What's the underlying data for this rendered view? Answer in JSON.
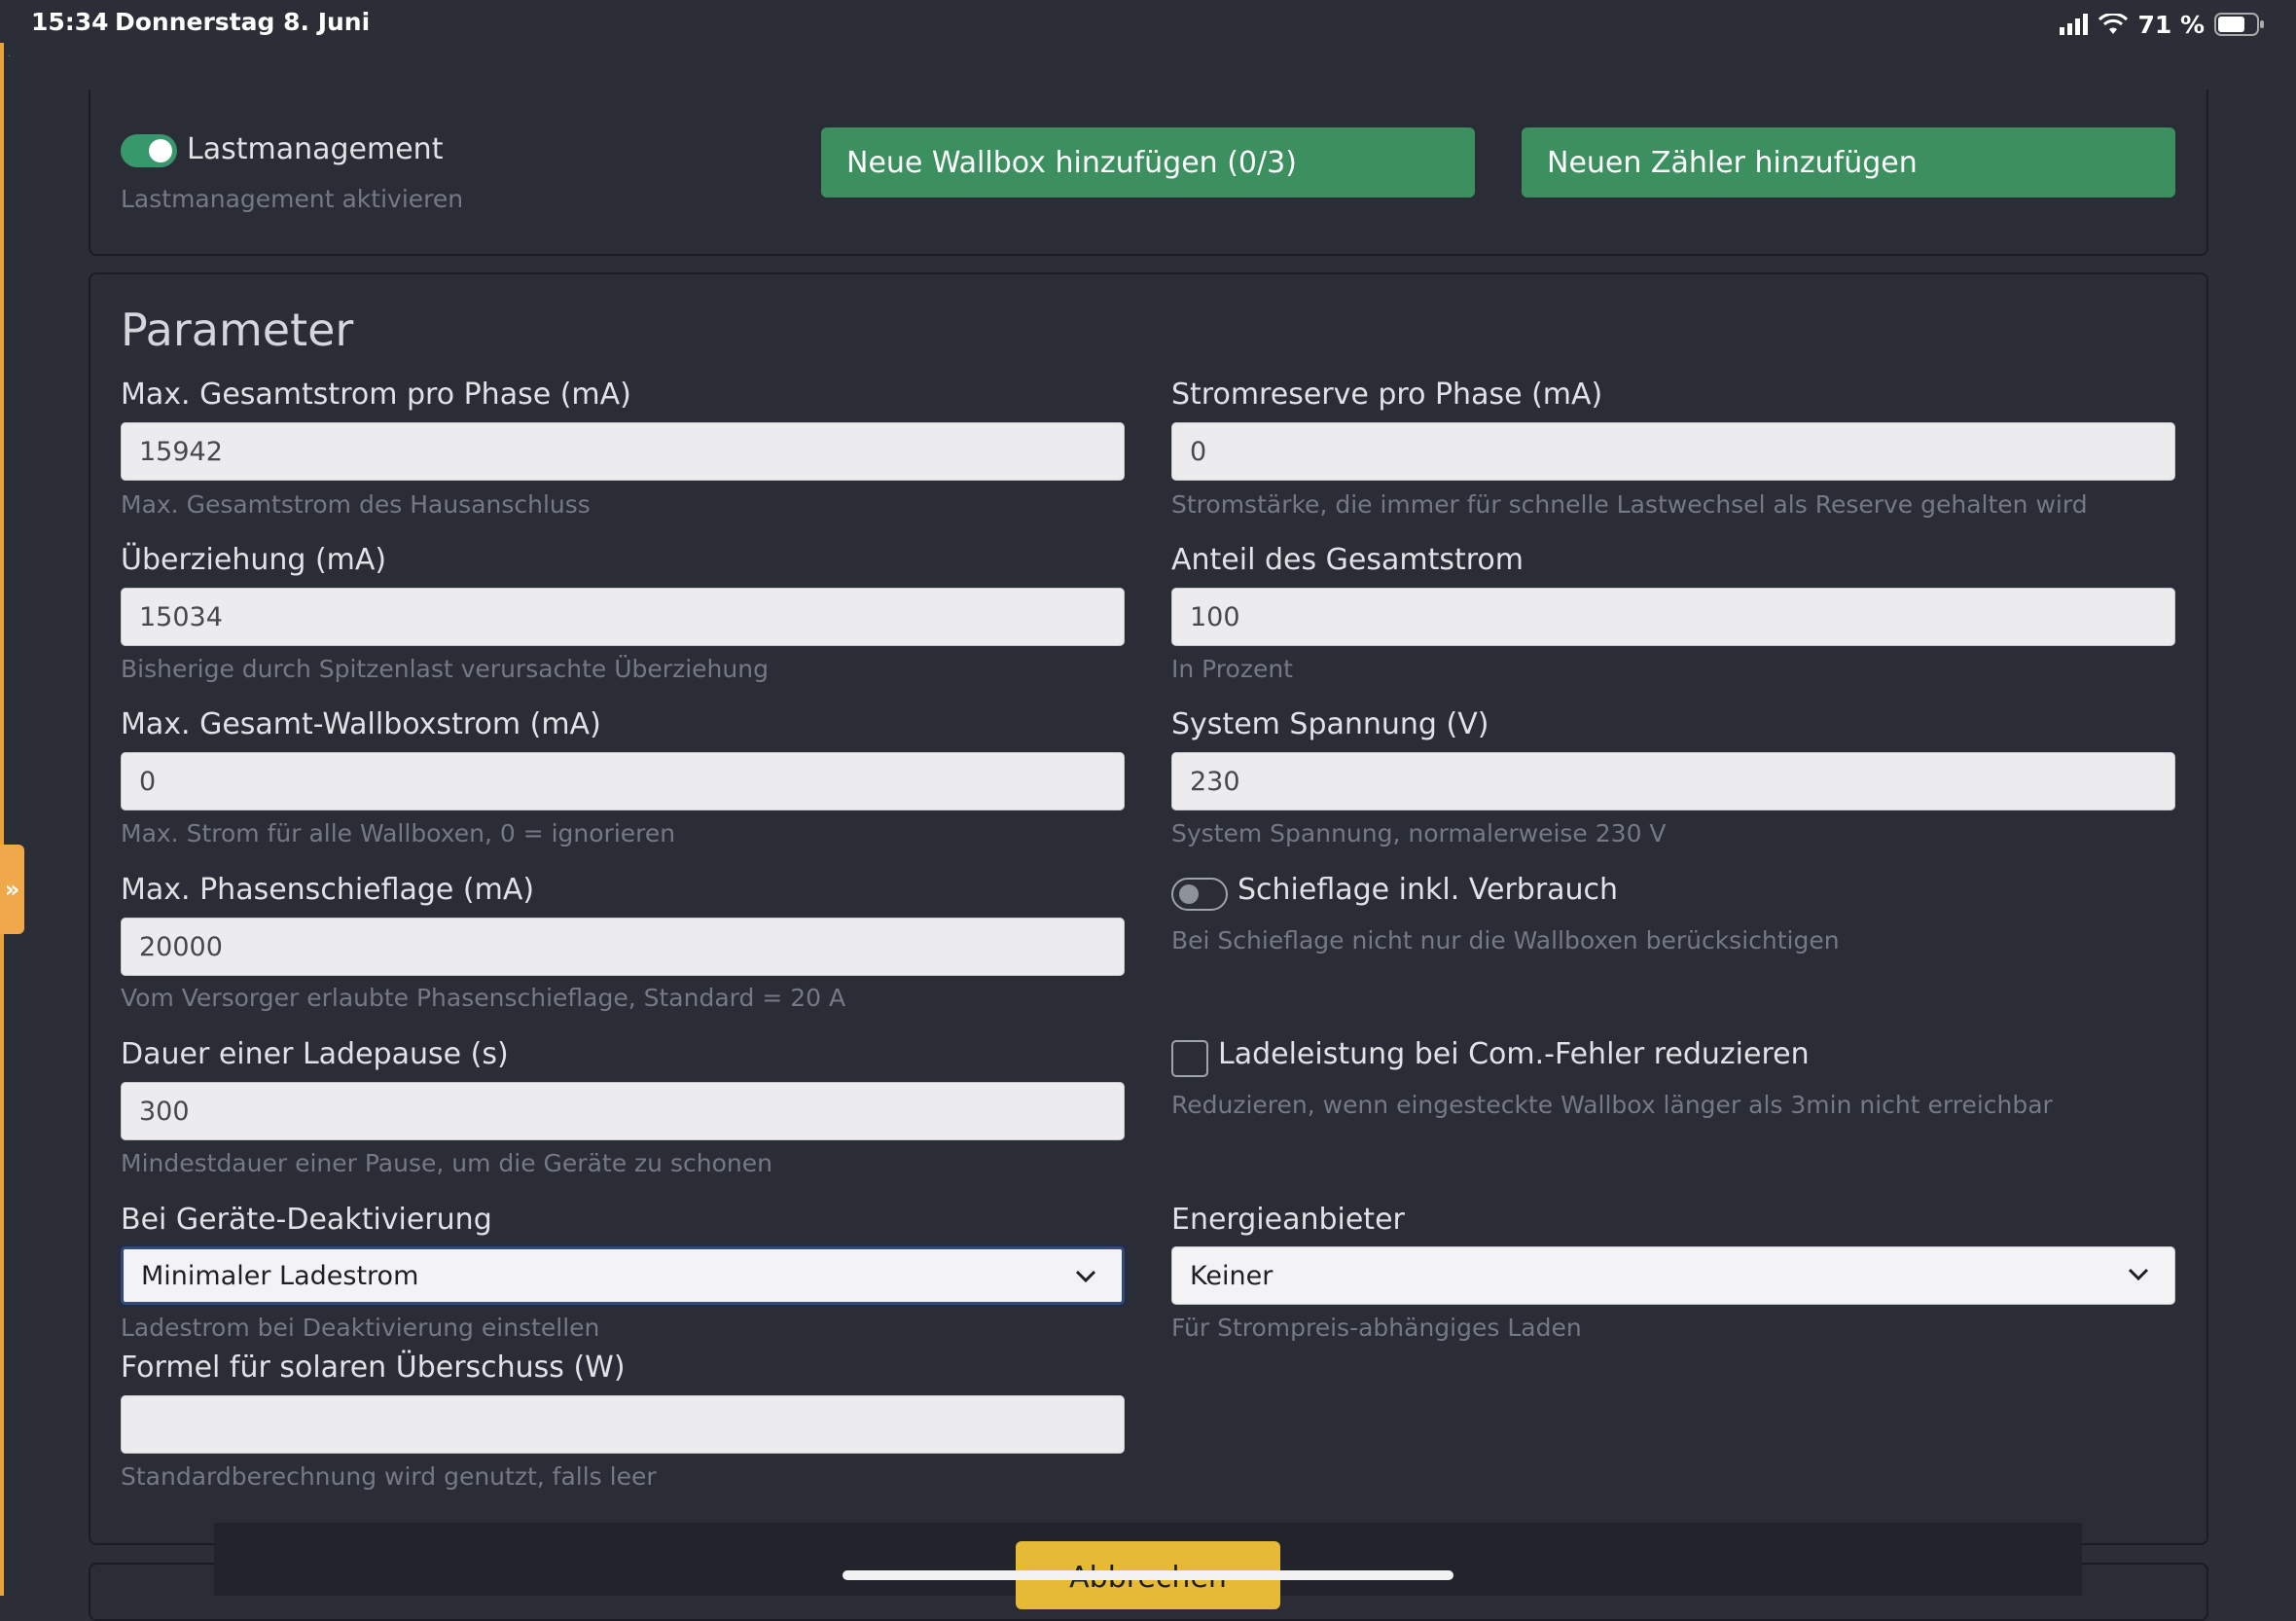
{
  "status_bar": {
    "time": "15:34",
    "date": "Donnerstag 8. Juni",
    "battery_percent": "71 %",
    "battery_level": 0.71
  },
  "load_management": {
    "toggle_label": "Lastmanagement",
    "toggle_on": true,
    "help": "Lastmanagement aktivieren",
    "add_wallbox_label": "Neue Wallbox hinzufügen (0/3)",
    "add_meter_label": "Neuen Zähler hinzufügen"
  },
  "parameter": {
    "title": "Parameter",
    "max_total_current": {
      "label": "Max. Gesamtstrom pro Phase (mA)",
      "value": "15942",
      "help": "Max. Gesamtstrom des Hausanschluss"
    },
    "current_reserve": {
      "label": "Stromreserve pro Phase (mA)",
      "value": "0",
      "help": "Stromstärke, die immer für schnelle Lastwechsel als Reserve gehalten wird"
    },
    "overdraw": {
      "label": "Überziehung (mA)",
      "value": "15034",
      "help": "Bisherige durch Spitzenlast verursachte Überziehung"
    },
    "share_total": {
      "label": "Anteil des Gesamtstrom",
      "value": "100",
      "help": "In Prozent"
    },
    "max_wallbox_current": {
      "label": "Max. Gesamt-Wallboxstrom (mA)",
      "value": "0",
      "help": "Max. Strom für alle Wallboxen, 0 = ignorieren"
    },
    "system_voltage": {
      "label": "System Spannung (V)",
      "value": "230",
      "help": "System Spannung, normalerweise 230 V"
    },
    "max_phase_imbalance": {
      "label": "Max. Phasenschieflage (mA)",
      "value": "20000",
      "help": "Vom Versorger erlaubte Phasenschieflage, Standard = 20 A"
    },
    "imbalance_incl_consumption": {
      "label": "Schieflage inkl. Verbrauch",
      "toggle_on": false,
      "help": "Bei Schieflage nicht nur die Wallboxen berücksichtigen"
    },
    "pause_duration": {
      "label": "Dauer einer Ladepause (s)",
      "value": "300",
      "help": "Mindestdauer einer Pause, um die Geräte zu schonen"
    },
    "reduce_on_com_error": {
      "label": "Ladeleistung bei Com.-Fehler reduzieren",
      "checked": false,
      "help": "Reduzieren, wenn eingesteckte Wallbox länger als 3min nicht erreichbar"
    },
    "on_device_deactivation": {
      "label": "Bei Geräte-Deaktivierung",
      "selected": "Minimaler Ladestrom",
      "help": "Ladestrom bei Deaktivierung einstellen"
    },
    "energy_provider": {
      "label": "Energieanbieter",
      "selected": "Keiner",
      "help": "Für Strompreis-abhängiges Laden"
    },
    "solar_formula": {
      "label": "Formel für solaren Überschuss (W)",
      "value": "",
      "help": "Standardberechnung wird genutzt, falls leer"
    }
  },
  "footer": {
    "cancel_label": "Abbrechen"
  }
}
